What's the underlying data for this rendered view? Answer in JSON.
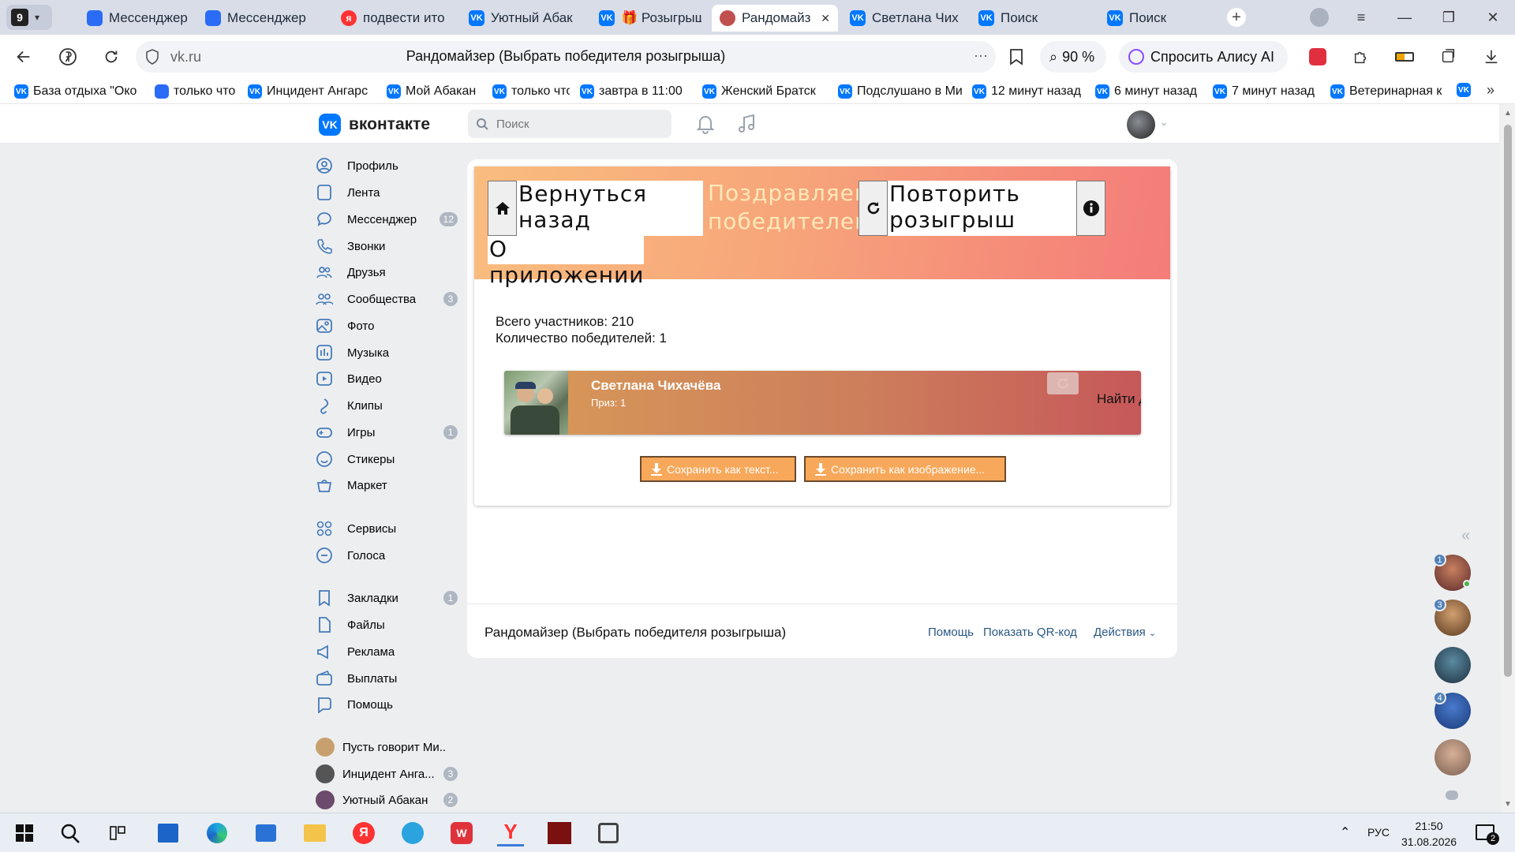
{
  "browser": {
    "tab_counter": "9",
    "tabs": [
      {
        "label": "Мессенджер",
        "icon": "messenger-icon"
      },
      {
        "label": "Мессенджер",
        "icon": "messenger-icon"
      },
      {
        "label": "подвести ито",
        "icon": "yandex-icon"
      },
      {
        "label": "Уютный Абак",
        "icon": "vk-icon"
      },
      {
        "label": "🎁 Розыгрыш",
        "icon": "vk-icon"
      },
      {
        "label": "Рандомайз",
        "icon": "randomizer-icon",
        "active": true
      },
      {
        "label": "Светлана Чих",
        "icon": "vk-icon"
      },
      {
        "label": "Поиск",
        "icon": "vk-icon"
      },
      {
        "label": "Поиск",
        "icon": "vk-icon"
      }
    ],
    "url": "vk.ru",
    "page_title": "Рандомайзер (Выбрать победителя розыгрыша)",
    "zoom": "90 %",
    "alice_label": "Спросить Алису AI",
    "bookmarks": [
      "База отдыха \"Око",
      "только что",
      "Инцидент Ангарс",
      "Мой Абакан",
      "только что",
      "завтра в 11:00",
      "Женский Братск",
      "Подслушано в Ми",
      "12 минут назад",
      "6 минут назад",
      "7 минут назад",
      "Ветеринарная к"
    ]
  },
  "vk": {
    "logo_text": "вконтакте",
    "search_placeholder": "Поиск",
    "sidebar": [
      {
        "label": "Профиль",
        "icon": "profile-icon"
      },
      {
        "label": "Лента",
        "icon": "feed-icon"
      },
      {
        "label": "Мессенджер",
        "icon": "messenger-icon",
        "count": "12"
      },
      {
        "label": "Звонки",
        "icon": "phone-icon"
      },
      {
        "label": "Друзья",
        "icon": "friends-icon"
      },
      {
        "label": "Сообщества",
        "icon": "communities-icon",
        "count": "3"
      },
      {
        "label": "Фото",
        "icon": "photo-icon"
      },
      {
        "label": "Музыка",
        "icon": "music-icon"
      },
      {
        "label": "Видео",
        "icon": "video-icon"
      },
      {
        "label": "Клипы",
        "icon": "clips-icon"
      },
      {
        "label": "Игры",
        "icon": "games-icon",
        "count": "1"
      },
      {
        "label": "Стикеры",
        "icon": "stickers-icon"
      },
      {
        "label": "Маркет",
        "icon": "market-icon"
      },
      {
        "label": "Сервисы",
        "icon": "services-icon"
      },
      {
        "label": "Голоса",
        "icon": "votes-icon"
      },
      {
        "label": "Закладки",
        "icon": "bookmarks-icon",
        "count": "1"
      },
      {
        "label": "Файлы",
        "icon": "files-icon"
      },
      {
        "label": "Реклама",
        "icon": "ads-icon"
      },
      {
        "label": "Выплаты",
        "icon": "payouts-icon"
      },
      {
        "label": "Помощь",
        "icon": "help-icon"
      },
      {
        "label": "Пусть говорит Ми...",
        "icon": "group-avatar"
      },
      {
        "label": "Инцидент Анга...",
        "icon": "group-avatar",
        "count": "3"
      },
      {
        "label": "Уютный Абакан",
        "icon": "group-avatar",
        "count": "2"
      }
    ]
  },
  "app": {
    "back_label": "Вернуться назад",
    "congrats": "Поздравляем победителей!",
    "repeat_label": "Повторить розыгрыш",
    "about_label": "О приложении",
    "total_participants": "Всего участников: 210",
    "winners_count": "Количество победителей: 1",
    "winner_name": "Светлана Чихачёва",
    "winner_prize": "Приз: 1",
    "find_other": "Найти другого",
    "save_text": "Сохранить как текст...",
    "save_image": "Сохранить как изображение..."
  },
  "footer": {
    "title": "Рандомайзер (Выбрать победителя розыгрыша)",
    "help": "Помощь",
    "qr": "Показать QR-код",
    "actions": "Действия"
  },
  "chats": [
    {
      "badge": "1",
      "online": true
    },
    {
      "badge": "3"
    },
    {
      "badge": ""
    },
    {
      "badge": "4"
    },
    {
      "badge": ""
    }
  ],
  "taskbar": {
    "lang": "РУС",
    "time": "21:50",
    "date": "31.08.2026",
    "notifications": "2"
  },
  "colors": {
    "vk_blue": "#0077ff",
    "link": "#2a5885",
    "banner_start": "#f9bd7e",
    "banner_end": "#f47c7a",
    "save_button": "#f7a85a"
  }
}
